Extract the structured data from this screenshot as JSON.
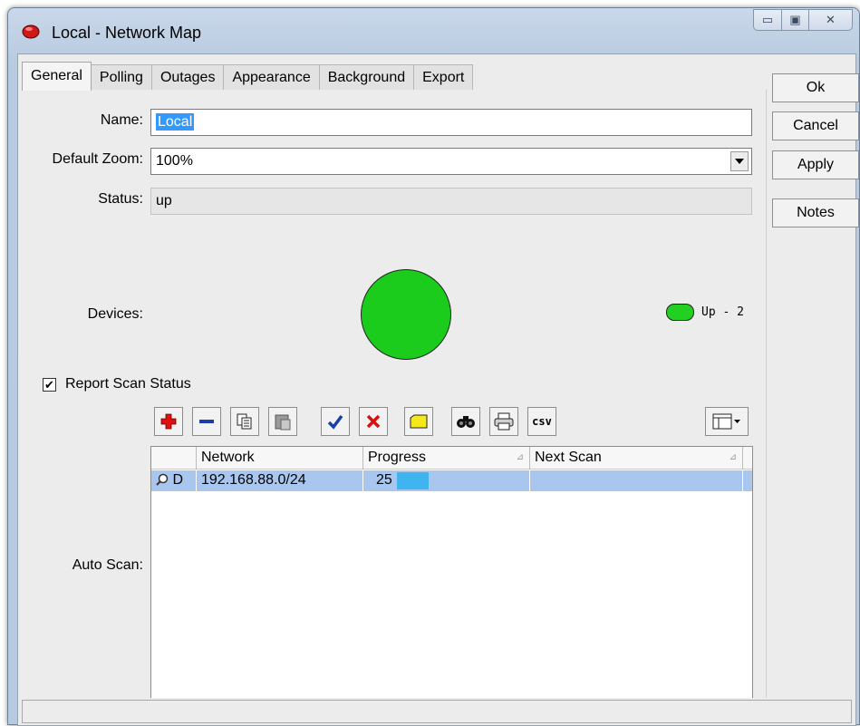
{
  "window": {
    "title": "Local - Network Map",
    "controls": {
      "minimize_icon": "minimize-icon",
      "maximize_icon": "maximize-icon",
      "close_icon": "close-icon"
    }
  },
  "tabs": [
    {
      "label": "General",
      "active": true
    },
    {
      "label": "Polling",
      "active": false
    },
    {
      "label": "Outages",
      "active": false
    },
    {
      "label": "Appearance",
      "active": false
    },
    {
      "label": "Background",
      "active": false
    },
    {
      "label": "Export",
      "active": false
    }
  ],
  "form": {
    "name_label": "Name:",
    "name_value": "Local",
    "zoom_label": "Default Zoom:",
    "zoom_value": "100%",
    "status_label": "Status:",
    "status_value": "up",
    "devices_label": "Devices:",
    "legend_text": "Up - 2",
    "legend_color": "#22d022",
    "report_scan_label": "Report Scan Status",
    "report_scan_checked": true,
    "autoscan_label": "Auto Scan:"
  },
  "toolbar": {
    "icons": [
      "add-icon",
      "remove-icon",
      "copy-icon",
      "paste-icon",
      "enable-icon",
      "disable-icon",
      "comment-icon",
      "find-icon",
      "print-icon",
      "csv-icon",
      "column-chooser-icon"
    ],
    "csv_label": "csv"
  },
  "table": {
    "columns": [
      "Network",
      "Progress",
      "Next Scan"
    ],
    "rows": [
      {
        "flag": "D",
        "network": "192.168.88.0/24",
        "progress": "25",
        "progress_value": 25,
        "next_scan": ""
      }
    ]
  },
  "buttons": {
    "ok": "Ok",
    "cancel": "Cancel",
    "apply": "Apply",
    "notes": "Notes"
  },
  "colors": {
    "device_up": "#1ccc1c",
    "row_selected": "#a9c7ee",
    "progress": "#3fb5f0"
  }
}
